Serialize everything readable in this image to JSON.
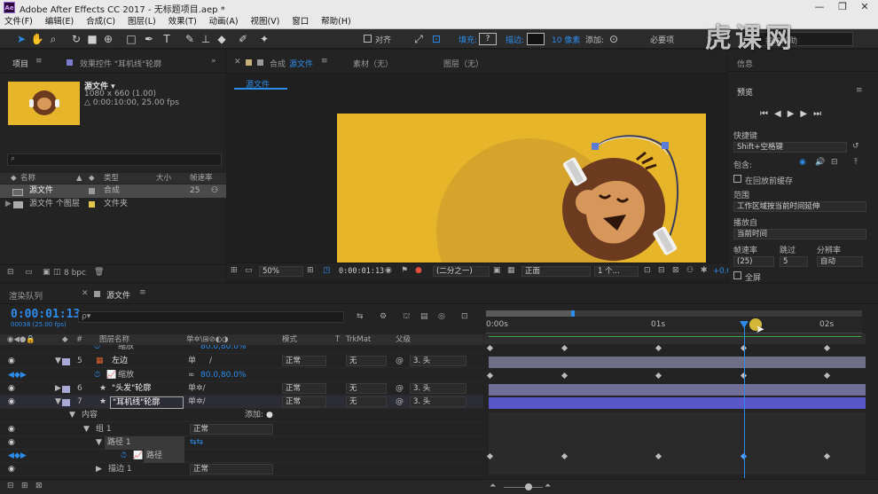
{
  "app": {
    "title": "Adobe After Effects CC 2017 - 无标题项目.aep *",
    "logo_text": "Ae",
    "window_controls": [
      "—",
      "❐",
      "✕"
    ]
  },
  "menu": [
    "文件(F)",
    "编辑(E)",
    "合成(C)",
    "图层(L)",
    "效果(T)",
    "动画(A)",
    "视图(V)",
    "窗口",
    "帮助(H)"
  ],
  "toolbar": {
    "align_label": "对齐",
    "fill_label": "填充:",
    "fill_value": "?",
    "stroke_label": "描边:",
    "stroke_width": "10 像素",
    "add_label": "添加:",
    "workspace": "必要项",
    "search_placeholder": "搜索帮助"
  },
  "project": {
    "tab_label": "项目",
    "effects_tab": "效果控件 \"耳机线\"轮廓",
    "comp_name": "源文件 ▾",
    "comp_info1": "1080 x 660 (1.00)",
    "comp_info2": "△ 0:00:10:00, 25.00 fps",
    "columns": {
      "name": "名称",
      "type": "类型",
      "size": "大小",
      "fps": "帧速率"
    },
    "items": [
      {
        "name": "源文件",
        "type": "合成",
        "size": "",
        "fps": "25",
        "color": "#9a9a9a"
      },
      {
        "name": "源文件 个图层",
        "type": "文件夹",
        "size": "",
        "fps": "",
        "color": "#e2c54a"
      }
    ],
    "bpc": "8 bpc"
  },
  "viewer": {
    "comp_tab_prefix": "合成",
    "comp_tab_name": "源文件",
    "footage_tab": "素材（无）",
    "layer_tab": "图层（无）",
    "sub_tab": "源文件",
    "zoom": "50%",
    "timecode": "0:00:01:13",
    "resolution": "(二分之一)",
    "view_mode": "正面",
    "views": "1 个...",
    "offset": "+0.0",
    "bg_color": "#e6b52a",
    "circle_color": "#d8a52a"
  },
  "right": {
    "info_tab": "信息",
    "preview_tab": "预览",
    "shortcut_label": "快捷键",
    "shortcut_value": "Shift+空格键",
    "include_label": "包含:",
    "cache_label": "在回放前缓存",
    "range_label": "范围",
    "range_value": "工作区域按当前时间延伸",
    "play_from_label": "播放自",
    "play_from_value": "当前时间",
    "fps_label": "帧速率",
    "skip_label": "跳过",
    "res_label": "分辨率",
    "fps_value": "(25)",
    "skip_value": "5",
    "res_value": "自动",
    "fullscreen_label": "全屏"
  },
  "timeline": {
    "render_tab": "渲染队列",
    "comp_tab": "源文件",
    "timecode": "0:00:01:13",
    "frame_info": "00038 (25.00 fps)",
    "search_placeholder": "ρ▾",
    "col_layer_name": "图层名称",
    "col_mode": "模式",
    "col_t": "T",
    "col_trkmat": "TrkMat",
    "col_parent": "父级",
    "ruler": [
      "0:00s",
      "01s",
      "02s"
    ],
    "top_partial": "缩放",
    "top_partial_value": "80.0,80.0%",
    "layers": [
      {
        "num": "5",
        "name": "左边",
        "mode": "正常",
        "trk": "无",
        "parent": "3. 头",
        "color": "#a9a9d6"
      },
      {
        "prop": "缩放",
        "value": "80.0,80.0%"
      },
      {
        "num": "6",
        "name": "\"头发\"轮廓",
        "mode": "正常",
        "trk": "无",
        "parent": "3. 头",
        "color": "#a9a9d6"
      },
      {
        "num": "7",
        "name": "\"耳机线\"轮廓",
        "mode": "正常",
        "trk": "无",
        "parent": "3. 头",
        "color": "#a9a9d6"
      }
    ],
    "content_label": "内容",
    "add_label": "添加:",
    "group_label": "组 1",
    "group_mode": "正常",
    "path_label": "路径 1",
    "path_prop": "路径",
    "stroke_label": "描边 1",
    "stroke_mode": "正常"
  },
  "watermark": "虎课网"
}
